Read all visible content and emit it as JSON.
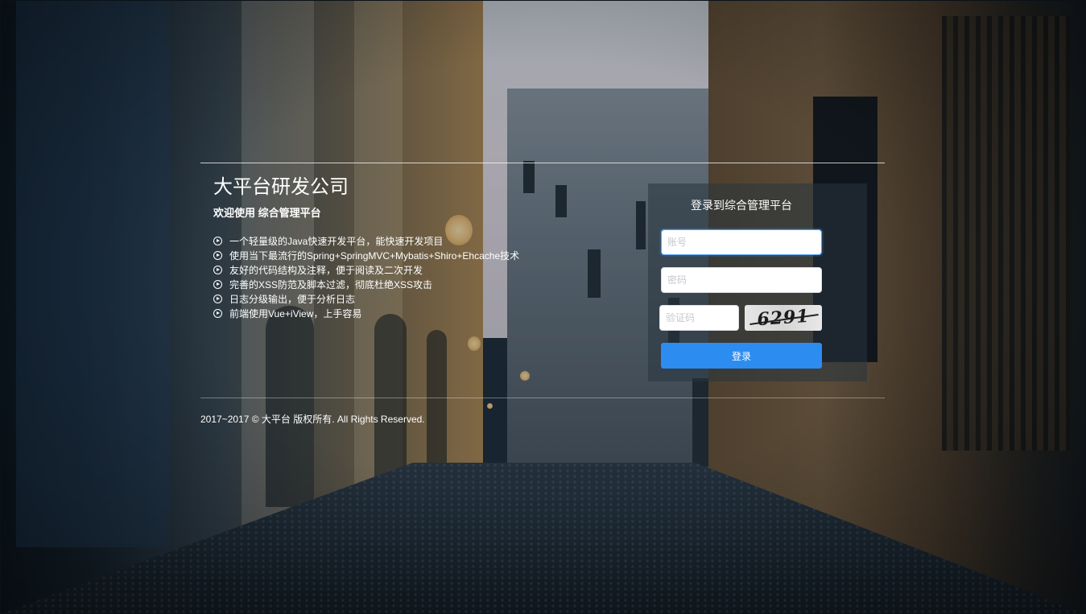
{
  "company": {
    "title": "大平台研发公司",
    "welcome": "欢迎使用 综合管理平台"
  },
  "features": [
    "一个轻量级的Java快速开发平台，能快速开发项目",
    "使用当下最流行的Spring+SpringMVC+Mybatis+Shiro+Ehcache技术",
    "友好的代码结构及注释，便于阅读及二次开发",
    "完善的XSS防范及脚本过滤，彻底杜绝XSS攻击",
    "日志分级输出，便于分析日志",
    "前端使用Vue+iView，上手容易"
  ],
  "feature_icon": "arrow-circle-right-icon",
  "login": {
    "title": "登录到综合管理平台",
    "account_placeholder": "账号",
    "password_placeholder": "密码",
    "captcha_placeholder": "验证码",
    "captcha_text": "6291",
    "button_label": "登录"
  },
  "footer": {
    "copyright": "2017~2017 © 大平台 版权所有. All Rights Reserved."
  },
  "colors": {
    "primary_button": "#2d8cf0",
    "focus_border": "#57a3f3"
  }
}
